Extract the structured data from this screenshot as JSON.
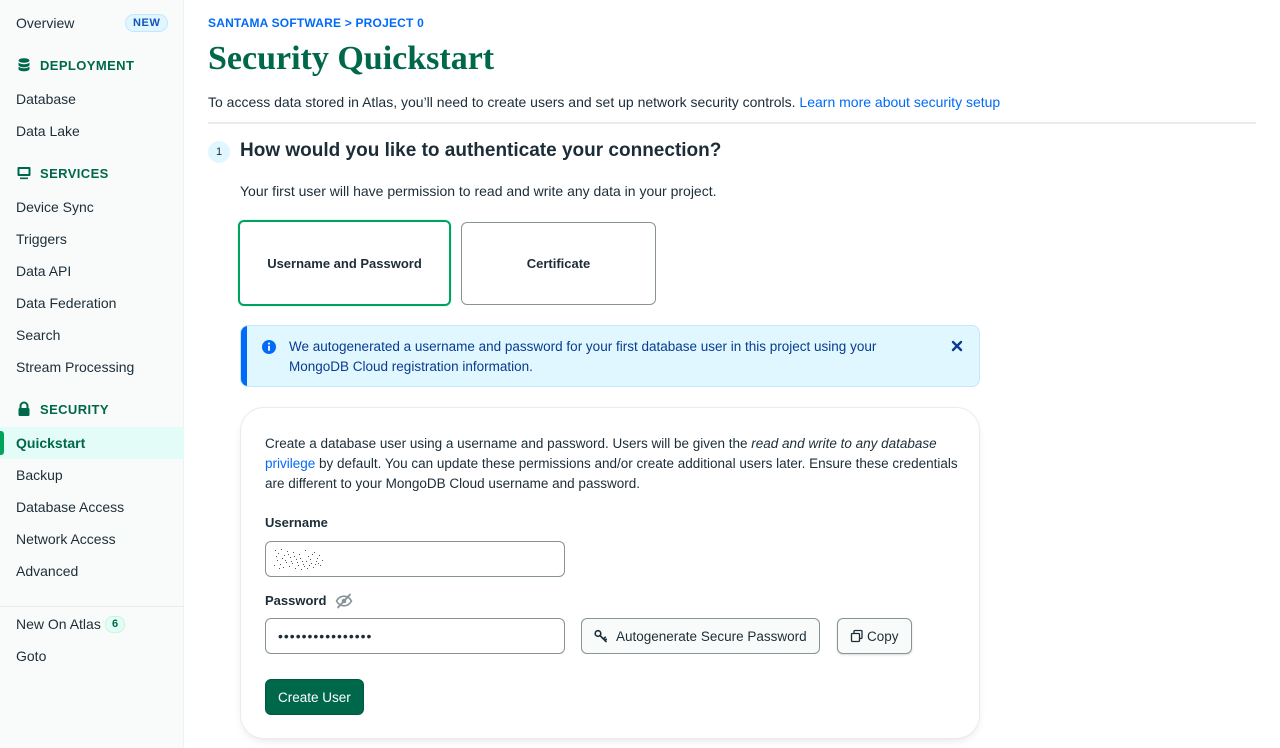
{
  "sidebar": {
    "overview": {
      "label": "Overview",
      "badge": "NEW"
    },
    "deployment": {
      "heading": "DEPLOYMENT",
      "icon": "database-icon",
      "items": [
        "Database",
        "Data Lake"
      ]
    },
    "services": {
      "heading": "SERVICES",
      "icon": "monitor-icon",
      "items": [
        "Device Sync",
        "Triggers",
        "Data API",
        "Data Federation",
        "Search",
        "Stream Processing"
      ]
    },
    "security": {
      "heading": "SECURITY",
      "icon": "lock-icon",
      "items": [
        "Quickstart",
        "Backup",
        "Database Access",
        "Network Access",
        "Advanced"
      ],
      "active": "Quickstart"
    },
    "footer": {
      "new_on_atlas": "New On Atlas",
      "new_count": "6",
      "goto": "Goto"
    }
  },
  "header": {
    "breadcrumb": "SANTAMA SOFTWARE > PROJECT 0",
    "title": "Security Quickstart",
    "intro": "To access data stored in Atlas, you’ll need to create users and set up network security controls.",
    "intro_link": "Learn more about security setup"
  },
  "step1": {
    "number": "1",
    "title": "How would you like to authenticate your connection?",
    "subtitle": "Your first user will have permission to read and write any data in your project.",
    "options": [
      "Username and Password",
      "Certificate"
    ],
    "selected": "Username and Password"
  },
  "callout": {
    "icon": "info-icon",
    "text": "We autogenerated a username and password for your first database user in this project using your MongoDB Cloud registration information."
  },
  "form": {
    "description_part1": "Create a database user using a username and password. Users will be given the ",
    "description_italic": "read and write to any database",
    "description_link": "privilege",
    "description_part2": " by default. You can update these permissions and/or create additional users later. Ensure these credentials are different to your MongoDB Cloud username and password.",
    "username_label": "Username",
    "password_label": "Password",
    "password_value": "••••••••••••••••",
    "autogenerate_label": "Autogenerate Secure Password",
    "copy_label": "Copy",
    "create_label": "Create User"
  },
  "colors": {
    "brand_green": "#00684a",
    "accent_green": "#00a35c",
    "link_blue": "#016bf8",
    "callout_bg": "#e1f7ff"
  }
}
